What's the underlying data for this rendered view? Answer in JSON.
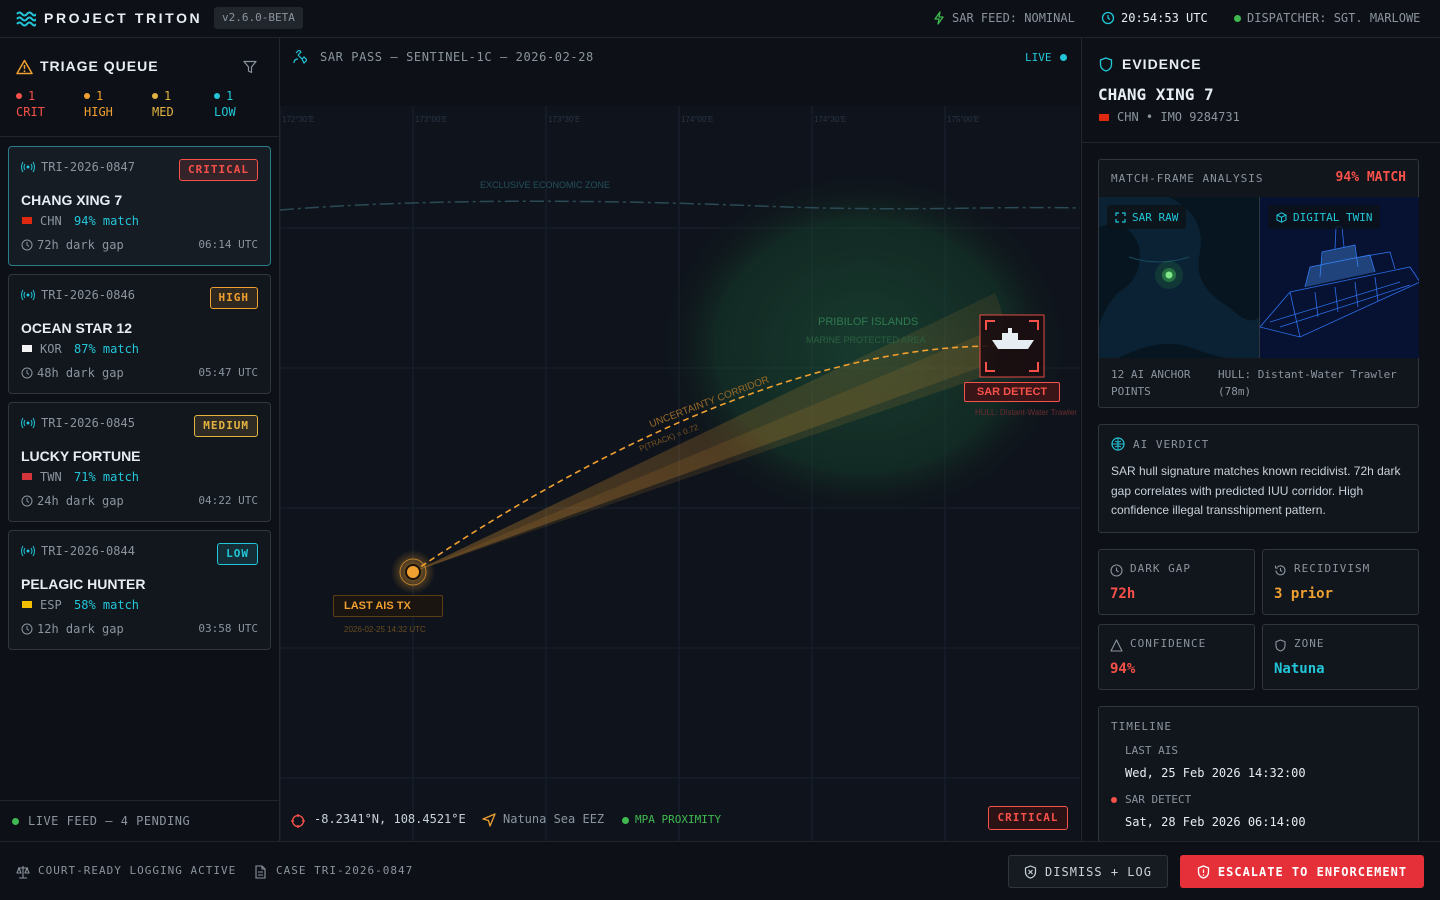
{
  "header": {
    "app_name": "PROJECT TRITON",
    "version": "v2.6.0-BETA",
    "sar_feed": "SAR FEED: NOMINAL",
    "clock": "20:54:53 UTC",
    "dispatcher": "DISPATCHER: SGT. MARLOWE"
  },
  "triage": {
    "title": "TRIAGE QUEUE",
    "counts": [
      {
        "n": "1",
        "label": "CRIT",
        "color": "#f85149"
      },
      {
        "n": "1",
        "label": "HIGH",
        "color": "#f0a030"
      },
      {
        "n": "1",
        "label": "MED",
        "color": "#e3b341"
      },
      {
        "n": "1",
        "label": "LOW",
        "color": "#22c6d8"
      }
    ],
    "cards": [
      {
        "id": "TRI-2026-0847",
        "badge": "CRITICAL",
        "vessel": "CHANG XING 7",
        "country": "CHN",
        "match": "94% match",
        "gap": "72h dark gap",
        "time": "06:14 UTC"
      },
      {
        "id": "TRI-2026-0846",
        "badge": "HIGH",
        "vessel": "OCEAN STAR 12",
        "country": "KOR",
        "match": "87% match",
        "gap": "48h dark gap",
        "time": "05:47 UTC"
      },
      {
        "id": "TRI-2026-0845",
        "badge": "MEDIUM",
        "vessel": "LUCKY FORTUNE",
        "country": "TWN",
        "match": "71% match",
        "gap": "24h dark gap",
        "time": "04:22 UTC"
      },
      {
        "id": "TRI-2026-0844",
        "badge": "LOW",
        "vessel": "PELAGIC HUNTER",
        "country": "ESP",
        "match": "58% match",
        "gap": "12h dark gap",
        "time": "03:58 UTC"
      }
    ],
    "badge_colors": {
      "CRITICAL": "#f85149",
      "HIGH": "#f0a030",
      "MEDIUM": "#e3b341",
      "LOW": "#22c6d8"
    },
    "live_feed": "LIVE FEED — 4 PENDING"
  },
  "map": {
    "pass_title": "SAR PASS — SENTINEL-1C — 2026-02-28",
    "live": "LIVE",
    "lon_ticks": [
      "172°30'E",
      "173°00'E",
      "173°30'E",
      "174°00'E",
      "174°30'E",
      "175°00'E"
    ],
    "eez_label": "EXCLUSIVE ECONOMIC ZONE",
    "island_label": "PRIBILOF ISLANDS",
    "mpa_label": "MARINE PROTECTED AREA",
    "corridor_label": "UNCERTAINTY CORRIDOR",
    "ptrack_label": "P(TRACK) = 0.72",
    "sar_detect": "SAR DETECT",
    "hull_note": "HULL: Distant-Water Trawler",
    "last_ais": "LAST AIS TX",
    "last_ais_time": "2026-02-25 14:32 UTC",
    "coords": "-8.2341°N, 108.4521°E",
    "eez": "Natuna Sea EEZ",
    "mpa": "MPA PROXIMITY",
    "status": "CRITICAL"
  },
  "evidence": {
    "title": "EVIDENCE",
    "vessel": "CHANG XING 7",
    "meta": "CHN • IMO 9284731",
    "mfa_title": "MATCH-FRAME ANALYSIS",
    "mfa_match": "94% MATCH",
    "sar_raw": "SAR RAW",
    "digital_twin": "DIGITAL TWIN",
    "anchor": "12 AI ANCHOR POINTS",
    "hull": "HULL: Distant-Water Trawler (78m)",
    "verdict_title": "AI VERDICT",
    "verdict": "SAR hull signature matches known recidivist. 72h dark gap correlates with predicted IUU corridor. High confidence illegal transshipment pattern.",
    "stats": [
      {
        "label": "DARK GAP",
        "value": "72h",
        "color": "#f85149"
      },
      {
        "label": "RECIDIVISM",
        "value": "3 prior",
        "color": "#f0a030"
      },
      {
        "label": "CONFIDENCE",
        "value": "94%",
        "color": "#f85149"
      },
      {
        "label": "ZONE",
        "value": "Natuna",
        "color": "#22c6d8"
      }
    ],
    "timeline_title": "TIMELINE",
    "timeline": [
      {
        "label": "LAST AIS",
        "value": "Wed, 25 Feb 2026 14:32:00"
      },
      {
        "label": "SAR DETECT",
        "value": "Sat, 28 Feb 2026 06:14:00"
      }
    ]
  },
  "footer": {
    "logging": "COURT-READY LOGGING ACTIVE",
    "case": "CASE TRI-2026-0847",
    "dismiss": "DISMISS + LOG",
    "escalate": "ESCALATE TO ENFORCEMENT"
  }
}
